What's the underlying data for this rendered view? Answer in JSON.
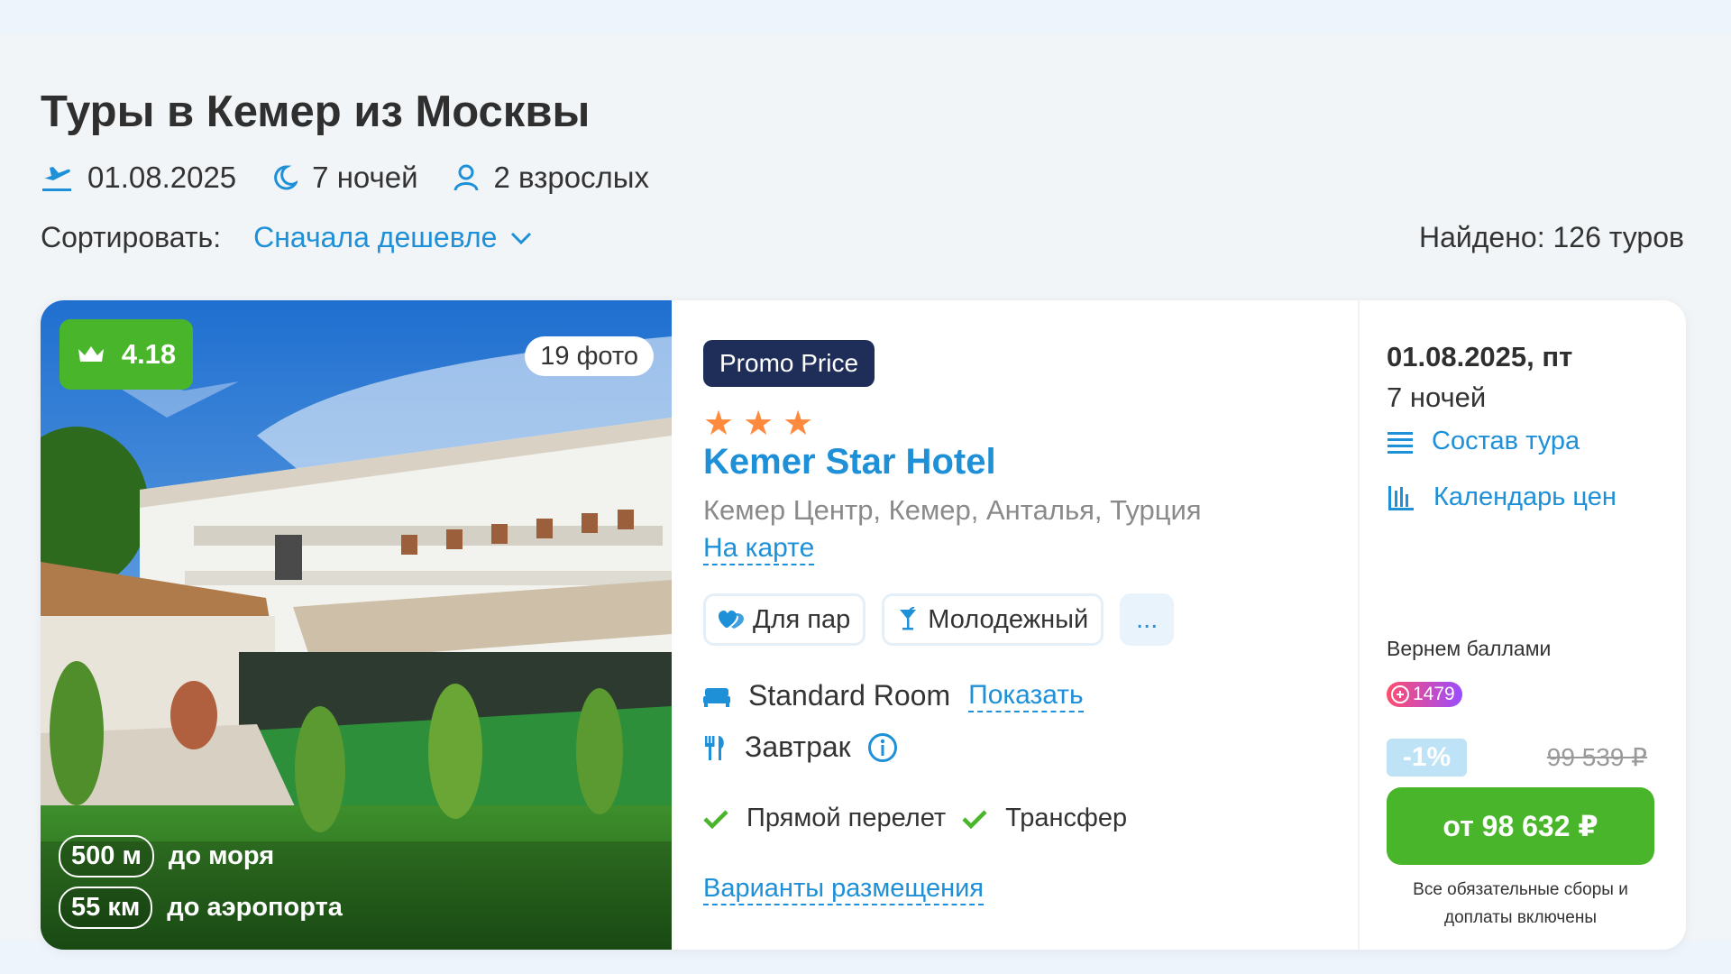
{
  "colors": {
    "accent": "#1e90d8",
    "green": "#49b52a",
    "promo": "#1f2e59",
    "star": "#ff8a3d"
  },
  "header": {
    "title": "Туры в Кемер из Москвы",
    "date": "01.08.2025",
    "nights": "7 ночей",
    "guests": "2 взрослых",
    "date_icon": "plane-departure-icon",
    "nights_icon": "moon-icon",
    "guests_icon": "person-icon"
  },
  "sort": {
    "label": "Сортировать:",
    "value": "Сначала дешевле"
  },
  "found": "Найдено: 126 туров",
  "card": {
    "photo": {
      "rating": "4.18",
      "photos_count": "19 фото",
      "sea_distance_value": "500 м",
      "sea_distance_label": "до моря",
      "airport_distance_value": "55 км",
      "airport_distance_label": "до аэропорта"
    },
    "promo_label": "Promo Price",
    "stars": [
      "★",
      "★",
      "★"
    ],
    "hotel_name": "Kemer Star Hotel",
    "location": "Кемер Центр, Кемер, Анталья, Турция",
    "map_link": "На карте",
    "tags": [
      {
        "label": "Для пар",
        "icon": "hearts-icon"
      },
      {
        "label": "Молодежный",
        "icon": "cocktail-icon"
      }
    ],
    "more_tags": "...",
    "room": "Standard Room",
    "room_show_link": "Показать",
    "meal": "Завтрак",
    "features": [
      "Прямой перелет",
      "Трансфер"
    ],
    "variants_link": "Варианты размещения",
    "side": {
      "date": "01.08.2025, пт",
      "nights": "7 ночей",
      "composition_link": "Состав тура",
      "calendar_link": "Календарь цен",
      "bonus_label": "Вернем баллами",
      "bonus_points": "1479",
      "discount": "-1%",
      "old_price": "99 539 ₽",
      "price_button": "от 98 632 ₽",
      "fees_note": "Все обязательные сборы и доплаты включены"
    }
  }
}
